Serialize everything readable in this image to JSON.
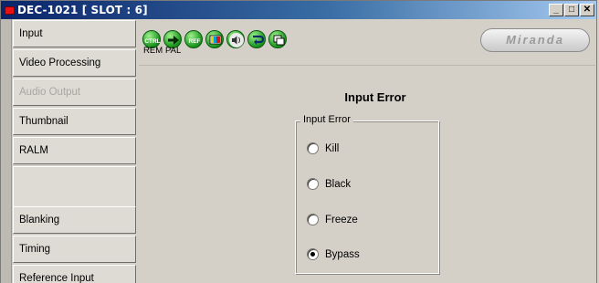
{
  "window": {
    "title": "DEC-1021 [ SLOT : 6]",
    "min": "_",
    "max": "□",
    "close": "✕"
  },
  "sidebar": {
    "items": [
      {
        "label": "Input",
        "state": "normal"
      },
      {
        "label": "Video Processing",
        "state": "normal"
      },
      {
        "label": "Audio Output",
        "state": "disabled"
      },
      {
        "label": "Thumbnail",
        "state": "normal"
      },
      {
        "label": "RALM",
        "state": "normal"
      },
      {
        "label": "",
        "state": "blank"
      },
      {
        "label": "Blanking",
        "state": "normal"
      },
      {
        "label": "Timing",
        "state": "normal"
      },
      {
        "label": "Reference Input",
        "state": "normal"
      }
    ]
  },
  "toolbar": {
    "icons": [
      {
        "name": "ctrl-icon",
        "text": "CTRL"
      },
      {
        "name": "arrow-right-icon",
        "text": ""
      },
      {
        "name": "ref-icon",
        "text": "REF"
      },
      {
        "name": "monitor-icon",
        "text": ""
      },
      {
        "name": "speaker-icon",
        "text": ""
      },
      {
        "name": "loop-arrow-icon",
        "text": ""
      },
      {
        "name": "windows-icon",
        "text": ""
      }
    ],
    "rem_label": "REM",
    "pal_label": "PAL",
    "logo": "Miranda"
  },
  "panel": {
    "title": "Input Error",
    "group_title": "Input Error",
    "options": [
      {
        "label": "Kill",
        "checked": false
      },
      {
        "label": "Black",
        "checked": false
      },
      {
        "label": "Freeze",
        "checked": false
      },
      {
        "label": "Bypass",
        "checked": true
      }
    ]
  },
  "colors": {
    "title_bar": "#0a246a",
    "accent_green": "#1e9a22",
    "led_red": "#e81010"
  }
}
